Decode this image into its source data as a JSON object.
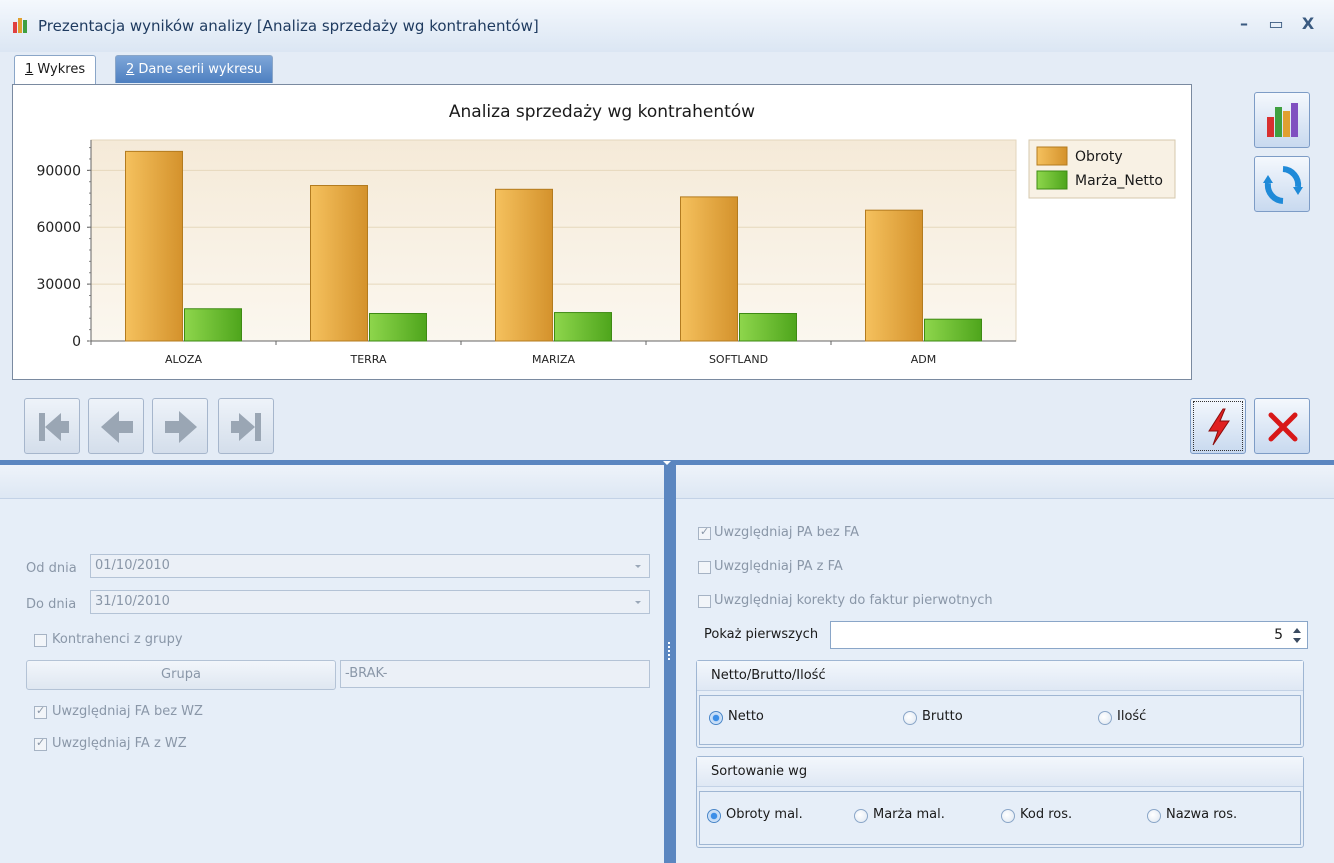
{
  "window": {
    "title": "Prezentacja wyników analizy [Analiza sprzedaży wg kontrahentów]",
    "minimize": "–",
    "maximize": "▭",
    "close": "X"
  },
  "tabs": [
    {
      "num": "1",
      "label": " Wykres"
    },
    {
      "num": "2",
      "label": " Dane serii wykresu"
    }
  ],
  "chart_data": {
    "type": "bar",
    "title": "Analiza sprzedaży wg kontrahentów",
    "categories": [
      "ALOZA",
      "TERRA",
      "MARIZA",
      "SOFTLAND",
      "ADM"
    ],
    "series": [
      {
        "name": "Obroty",
        "values": [
          100000,
          82000,
          80000,
          76000,
          69000
        ],
        "color": "#e0a83a"
      },
      {
        "name": "Marża_Netto",
        "values": [
          17000,
          14500,
          15000,
          14500,
          11500
        ],
        "color": "#6cbf2a"
      }
    ],
    "yticks": [
      "0",
      "30000",
      "60000",
      "90000"
    ],
    "ylim": [
      0,
      106000
    ],
    "legend": "top-right",
    "grid": true
  },
  "left_panel": {
    "od_dnia_label": "Od dnia",
    "od_dnia_value": "01/10/2010",
    "do_dnia_label": "Do dnia",
    "do_dnia_value": "31/10/2010",
    "kontrahenci_label": "Kontrahenci z grupy",
    "grupa_button": "Grupa",
    "grupa_value": "-BRAK-",
    "fa_bez_wz_label": "Uwzględniaj FA bez WZ",
    "fa_z_wz_label": "Uwzględniaj FA z WZ"
  },
  "right_panel": {
    "pa_bez_fa_label": "Uwzględniaj PA bez FA",
    "pa_z_fa_label": "Uwzględniaj PA z FA",
    "korekty_label": "Uwzględniaj korekty do faktur pierwotnych",
    "pokaz_label": "Pokaż pierwszych",
    "pokaz_value": "5",
    "netto_group_title": "Netto/Brutto/Ilość",
    "netto_options": [
      "Netto",
      "Brutto",
      "Ilość"
    ],
    "sort_group_title": "Sortowanie wg",
    "sort_options": [
      "Obroty mal.",
      "Marża mal.",
      "Kod ros.",
      "Nazwa ros."
    ]
  },
  "colors": {
    "accent": "#5b86c0",
    "danger": "#d81818"
  }
}
